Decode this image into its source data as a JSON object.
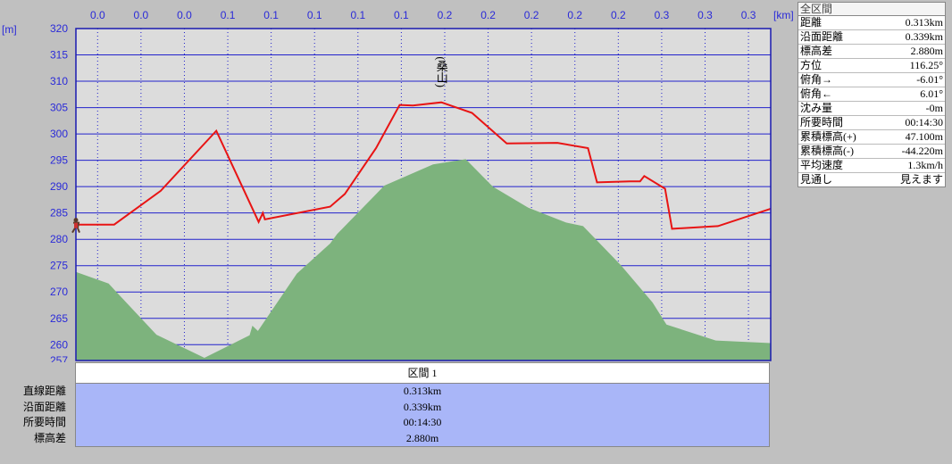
{
  "chart_data": {
    "type": "area",
    "xlabel": "[km]",
    "ylabel": "[m]",
    "ylim": [
      257,
      320
    ],
    "yticks": [
      320,
      315,
      310,
      305,
      300,
      295,
      290,
      285,
      280,
      275,
      270,
      265,
      260,
      257
    ],
    "xtick_labels": [
      "0.0",
      "0.0",
      "0.0",
      "0.1",
      "0.1",
      "0.1",
      "0.1",
      "0.1",
      "0.2",
      "0.2",
      "0.2",
      "0.2",
      "0.2",
      "0.3",
      "0.3",
      "0.3"
    ],
    "grid": true,
    "series": [
      {
        "kind": "terrain",
        "x": [
          0.0,
          0.047,
          0.116,
          0.185,
          0.25,
          0.254,
          0.262,
          0.318,
          0.366,
          0.376,
          0.444,
          0.514,
          0.561,
          0.6,
          0.651,
          0.705,
          0.73,
          0.785,
          0.83,
          0.85,
          0.921,
          1.0
        ],
        "values": [
          273.8,
          271.6,
          261.9,
          257.5,
          261.8,
          263.6,
          262.6,
          273.5,
          279.2,
          281.0,
          290.2,
          294.2,
          295.2,
          290.0,
          286.0,
          283.2,
          282.5,
          275.0,
          268.0,
          263.8,
          260.8,
          260.3
        ]
      },
      {
        "kind": "route",
        "x": [
          0.0,
          0.055,
          0.122,
          0.202,
          0.263,
          0.269,
          0.272,
          0.366,
          0.387,
          0.432,
          0.466,
          0.485,
          0.526,
          0.57,
          0.62,
          0.693,
          0.737,
          0.75,
          0.798,
          0.812,
          0.818,
          0.848,
          0.858,
          0.924,
          1.0
        ],
        "values": [
          282.8,
          282.8,
          289.2,
          300.6,
          283.3,
          285.0,
          283.8,
          286.2,
          288.6,
          297.3,
          305.5,
          305.4,
          306.0,
          304.0,
          298.2,
          298.3,
          297.3,
          290.8,
          291.0,
          291.0,
          292.0,
          289.6,
          282.0,
          282.5,
          285.8
        ]
      }
    ],
    "annotations": [
      {
        "text": "(桑山)",
        "x": 0.526,
        "y": 306.0
      }
    ],
    "colors": {
      "terrain_fill": "#7db37d",
      "route_line": "#e81414",
      "grid": "#2222cc",
      "plot_bg": "#dcdcdc",
      "axis_text": "#2a2ad8"
    }
  },
  "stats_panel": {
    "header": "全区間",
    "rows": [
      {
        "label": "距離",
        "value": "0.313km"
      },
      {
        "label": "沿面距離",
        "value": "0.339km"
      },
      {
        "label": "標高差",
        "value": "2.880m"
      },
      {
        "label": "方位",
        "value": "116.25°"
      },
      {
        "label": "俯角→",
        "value": "-6.01°"
      },
      {
        "label": "俯角←",
        "value": "6.01°"
      },
      {
        "label": "沈み量",
        "value": "-0m"
      },
      {
        "label": "所要時間",
        "value": "00:14:30"
      },
      {
        "label": "累積標高(+)",
        "value": "47.100m"
      },
      {
        "label": "累積標高(-)",
        "value": "-44.220m"
      },
      {
        "label": "平均速度",
        "value": "1.3km/h"
      },
      {
        "label": "見通し",
        "value": "見えます"
      }
    ]
  },
  "segment_table": {
    "title": "区間 1",
    "labels": [
      "直線距離",
      "沿面距離",
      "所要時間",
      "標高差"
    ],
    "values": [
      "0.313km",
      "0.339km",
      "00:14:30",
      "2.880m"
    ]
  }
}
